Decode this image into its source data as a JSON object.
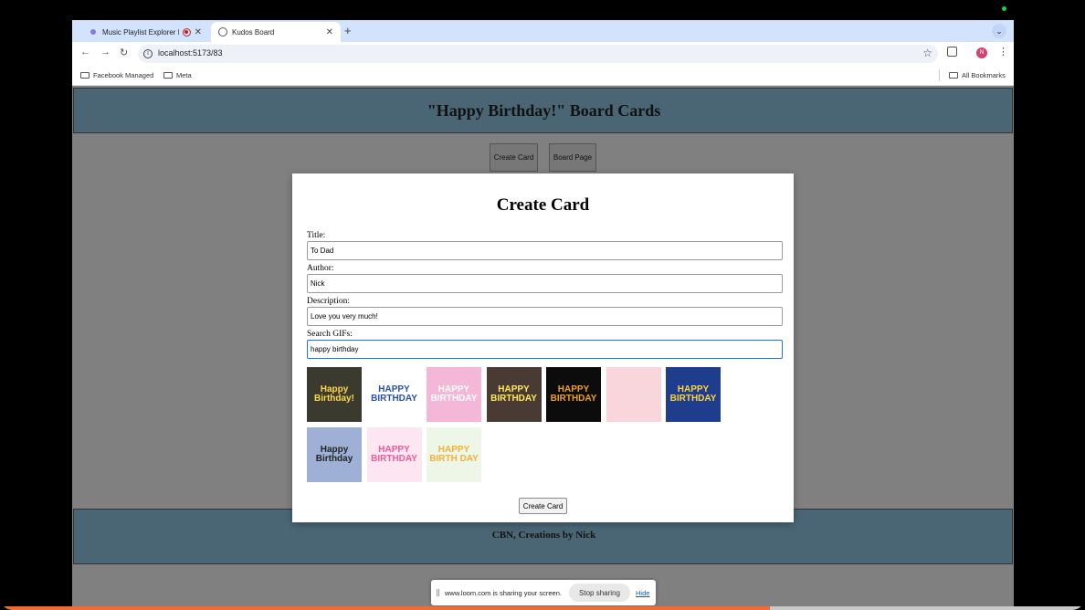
{
  "browser": {
    "tabs": [
      {
        "title": "Music Playlist Explorer De",
        "active": false,
        "recording": true
      },
      {
        "title": "Kudos Board",
        "active": true
      }
    ],
    "url": "localhost:5173/83",
    "avatar_letter": "N",
    "bookmarks": [
      {
        "label": "Facebook Managed"
      },
      {
        "label": "Meta"
      }
    ],
    "all_bookmarks_label": "All Bookmarks"
  },
  "page": {
    "header_title": "\"Happy Birthday!\" Board Cards",
    "create_card_button": "Create Card",
    "board_page_button": "Board Page",
    "footer_text": "CBN, Creations by Nick"
  },
  "modal": {
    "title": "Create Card",
    "fields": {
      "title": {
        "label": "Title:",
        "value": "To Dad"
      },
      "author": {
        "label": "Author:",
        "value": "Nick"
      },
      "description": {
        "label": "Description:",
        "value": "Love you very much!"
      },
      "search": {
        "label": "Search GIFs:",
        "value": "happy birthday"
      }
    },
    "gifs": [
      {
        "caption": "Happy Birthday!",
        "bg": "#3a3a2e",
        "fg": "#ffd84a"
      },
      {
        "caption": "HAPPY BIRTHDAY",
        "bg": "#ffffff",
        "fg": "#2a4fb0"
      },
      {
        "caption": "HAPPY BIRTHDAY",
        "bg": "#f5b7d7",
        "fg": "#ffffff"
      },
      {
        "caption": "HAPPY BIRTHDAY",
        "bg": "#4a3a34",
        "fg": "#ffea5a"
      },
      {
        "caption": "HAPPY BIRTHDAY",
        "bg": "#0c0c0c",
        "fg": "#f0a020"
      },
      {
        "caption": "",
        "bg": "#f8d6dc",
        "fg": "#b8a080"
      },
      {
        "caption": "HAPPY BIRTHDAY",
        "bg": "#1e3d8c",
        "fg": "#ffd23f"
      },
      {
        "caption": "Happy Birthday",
        "bg": "#9fb0d6",
        "fg": "#222222"
      },
      {
        "caption": "HAPPY BIRTHDAY",
        "bg": "#fbe6f2",
        "fg": "#f25a9a"
      },
      {
        "caption": "HAPPY BIRTH DAY",
        "bg": "#eef6e8",
        "fg": "#f1b23a"
      }
    ],
    "submit_label": "Create Card"
  },
  "loom": {
    "message": "www.loom.com is sharing your screen.",
    "stop_label": "Stop sharing",
    "hide_label": "Hide",
    "video_progress": 0.71
  },
  "colors": {
    "header_band": "#4a6675",
    "page_bg": "#808080",
    "tabstrip": "#d3e3fd",
    "focus": "#1a73e8",
    "progress": "#ef6b3a"
  }
}
